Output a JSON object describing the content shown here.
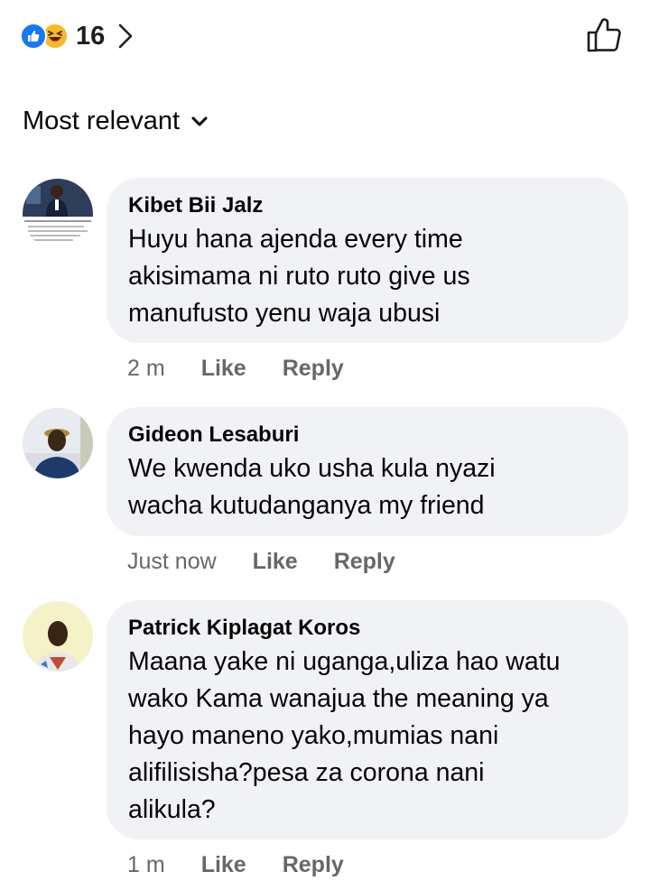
{
  "reactions": {
    "count": "16",
    "icons": [
      "like-icon",
      "haha-icon"
    ],
    "like_color": "#1877f2",
    "haha_color": "#f7b928"
  },
  "sort": {
    "label": "Most relevant"
  },
  "comments": [
    {
      "author": "Kibet Bii Jalz",
      "text": "Huyu hana ajenda every time\nakisimama ni ruto ruto give us\nmanufusto yenu waja ubusi",
      "time": "2 m",
      "like_label": "Like",
      "reply_label": "Reply"
    },
    {
      "author": "Gideon Lesaburi",
      "text": "We kwenda uko usha kula nyazi\nwacha kutudanganya my friend",
      "time": "Just now",
      "like_label": "Like",
      "reply_label": "Reply"
    },
    {
      "author": "Patrick Kiplagat Koros",
      "text": "Maana yake ni uganga,uliza hao watu\nwako Kama wanajua the meaning ya\nhayo maneno yako,mumias nani\nalifilisisha?pesa za corona nani\nalikula?",
      "time": "1 m",
      "like_label": "Like",
      "reply_label": "Reply"
    }
  ],
  "colors": {
    "bubble": "#f0f2f5",
    "meta_text": "#65676b",
    "accent": "#1877f2"
  }
}
